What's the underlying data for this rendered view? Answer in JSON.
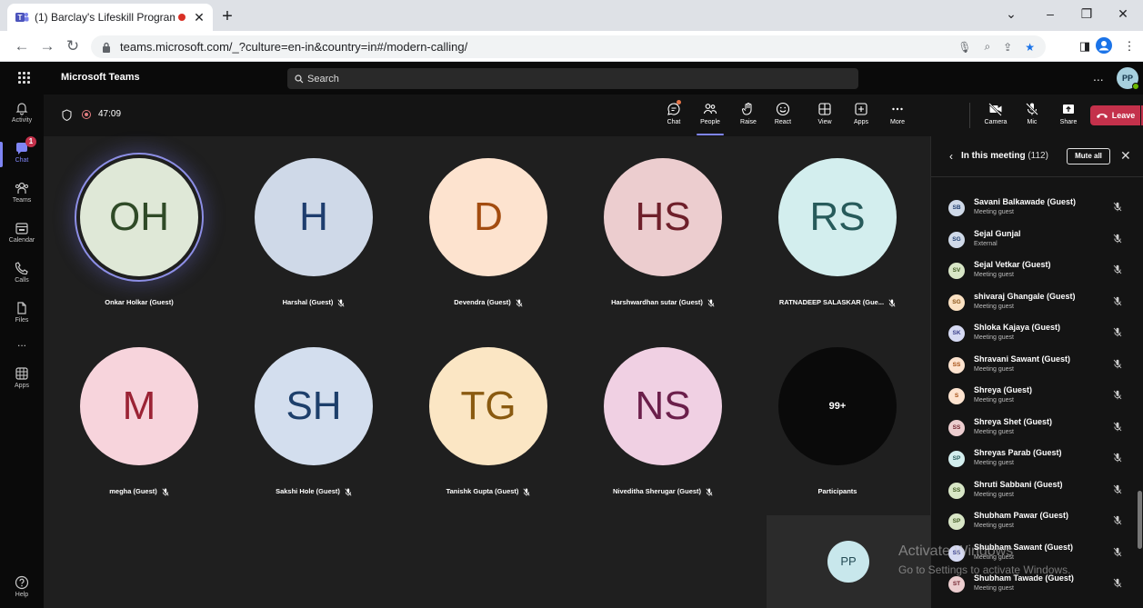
{
  "browser": {
    "tab_title": "(1) Barclay's Lifeskill Program",
    "url": "teams.microsoft.com/_?culture=en-in&country=in#/modern-calling/"
  },
  "teams": {
    "brand": "Microsoft Teams",
    "search_placeholder": "Search",
    "more_label": "...",
    "user_initials": "PP"
  },
  "rail": {
    "items": [
      {
        "label": "Activity",
        "icon": "bell-icon"
      },
      {
        "label": "Chat",
        "icon": "chat-icon",
        "badge": "1"
      },
      {
        "label": "Teams",
        "icon": "teams-icon"
      },
      {
        "label": "Calendar",
        "icon": "calendar-icon"
      },
      {
        "label": "Calls",
        "icon": "phone-icon"
      },
      {
        "label": "Files",
        "icon": "file-icon"
      },
      {
        "label": "...",
        "icon": "more-icon"
      },
      {
        "label": "Apps",
        "icon": "apps-icon"
      }
    ],
    "help_label": "Help"
  },
  "meeting": {
    "timer": "47:09",
    "controls": {
      "chat": "Chat",
      "people": "People",
      "raise": "Raise",
      "react": "React",
      "view": "View",
      "apps": "Apps",
      "more": "More",
      "camera": "Camera",
      "mic": "Mic",
      "share": "Share",
      "leave": "Leave"
    }
  },
  "stage": {
    "tiles": [
      {
        "initials": "OH",
        "name": "Onkar Holkar (Guest)",
        "bg": "#dfe8d7",
        "fg": "#2f4a27",
        "muted": false,
        "speaking": true
      },
      {
        "initials": "H",
        "name": "Harshal (Guest)",
        "bg": "#cfd9e8",
        "fg": "#1e3d6e",
        "muted": true,
        "speaking": false
      },
      {
        "initials": "D",
        "name": "Devendra (Guest)",
        "bg": "#fde3cf",
        "fg": "#a34c10",
        "muted": true,
        "speaking": false
      },
      {
        "initials": "HS",
        "name": "Harshwardhan sutar (Guest)",
        "bg": "#eccdcf",
        "fg": "#6e1f2a",
        "muted": true,
        "speaking": false
      },
      {
        "initials": "RS",
        "name": "RATNADEEP SALASKAR (Gue...",
        "bg": "#d3eeee",
        "fg": "#275b5b",
        "muted": true,
        "speaking": false
      },
      {
        "initials": "M",
        "name": "megha (Guest)",
        "bg": "#f7d4dc",
        "fg": "#9b2335",
        "muted": true,
        "speaking": false
      },
      {
        "initials": "SH",
        "name": "Sakshi Hole (Guest)",
        "bg": "#d3deee",
        "fg": "#1d3f6b",
        "muted": true,
        "speaking": false
      },
      {
        "initials": "TG",
        "name": "Tanishk Gupta (Guest)",
        "bg": "#fbe6c4",
        "fg": "#8a5a10",
        "muted": true,
        "speaking": false
      },
      {
        "initials": "NS",
        "name": "Niveditha Sherugar (Guest)",
        "bg": "#f0d0e3",
        "fg": "#6b1f4b",
        "muted": true,
        "speaking": false
      }
    ],
    "overflow": {
      "count": "99+",
      "label": "Participants"
    },
    "self_initials": "PP"
  },
  "panel": {
    "title": "In this meeting",
    "count": "(112)",
    "mute_all": "Mute all",
    "participants": [
      {
        "initials": "SB",
        "name": "Savani Balkawade (Guest)",
        "sub": "Meeting guest",
        "bg": "#cfd9e8",
        "fg": "#1e3d6e"
      },
      {
        "initials": "SG",
        "name": "Sejal Gunjal",
        "sub": "External",
        "bg": "#cfd9e8",
        "fg": "#1e3d6e"
      },
      {
        "initials": "SV",
        "name": "Sejal Vetkar (Guest)",
        "sub": "Meeting guest",
        "bg": "#d8e6c6",
        "fg": "#3f5a22"
      },
      {
        "initials": "SG",
        "name": "shivaraj Ghangale (Guest)",
        "sub": "Meeting guest",
        "bg": "#fbe1c2",
        "fg": "#8a5316"
      },
      {
        "initials": "SK",
        "name": "Shloka Kajaya (Guest)",
        "sub": "Meeting guest",
        "bg": "#d6daf3",
        "fg": "#3a3f8a"
      },
      {
        "initials": "SS",
        "name": "Shravani Sawant (Guest)",
        "sub": "Meeting guest",
        "bg": "#fde3cf",
        "fg": "#a34c10"
      },
      {
        "initials": "S",
        "name": "Shreya (Guest)",
        "sub": "Meeting guest",
        "bg": "#fde3cf",
        "fg": "#a34c10"
      },
      {
        "initials": "SS",
        "name": "Shreya Shet (Guest)",
        "sub": "Meeting guest",
        "bg": "#eccdcf",
        "fg": "#6e1f2a"
      },
      {
        "initials": "SP",
        "name": "Shreyas Parab (Guest)",
        "sub": "Meeting guest",
        "bg": "#d3eeee",
        "fg": "#275b5b"
      },
      {
        "initials": "SS",
        "name": "Shruti Sabbani (Guest)",
        "sub": "Meeting guest",
        "bg": "#d8e6c6",
        "fg": "#3f5a22"
      },
      {
        "initials": "SP",
        "name": "Shubham Pawar (Guest)",
        "sub": "Meeting guest",
        "bg": "#d8e6c6",
        "fg": "#3f5a22"
      },
      {
        "initials": "SS",
        "name": "Shubham Sawant (Guest)",
        "sub": "Meeting guest",
        "bg": "#d6daf3",
        "fg": "#3a3f8a"
      },
      {
        "initials": "ST",
        "name": "Shubham Tawade (Guest)",
        "sub": "Meeting guest",
        "bg": "#eccdcf",
        "fg": "#6e1f2a"
      }
    ]
  },
  "watermark": {
    "line1": "Activate Windows",
    "line2": "Go to Settings to activate Windows."
  }
}
